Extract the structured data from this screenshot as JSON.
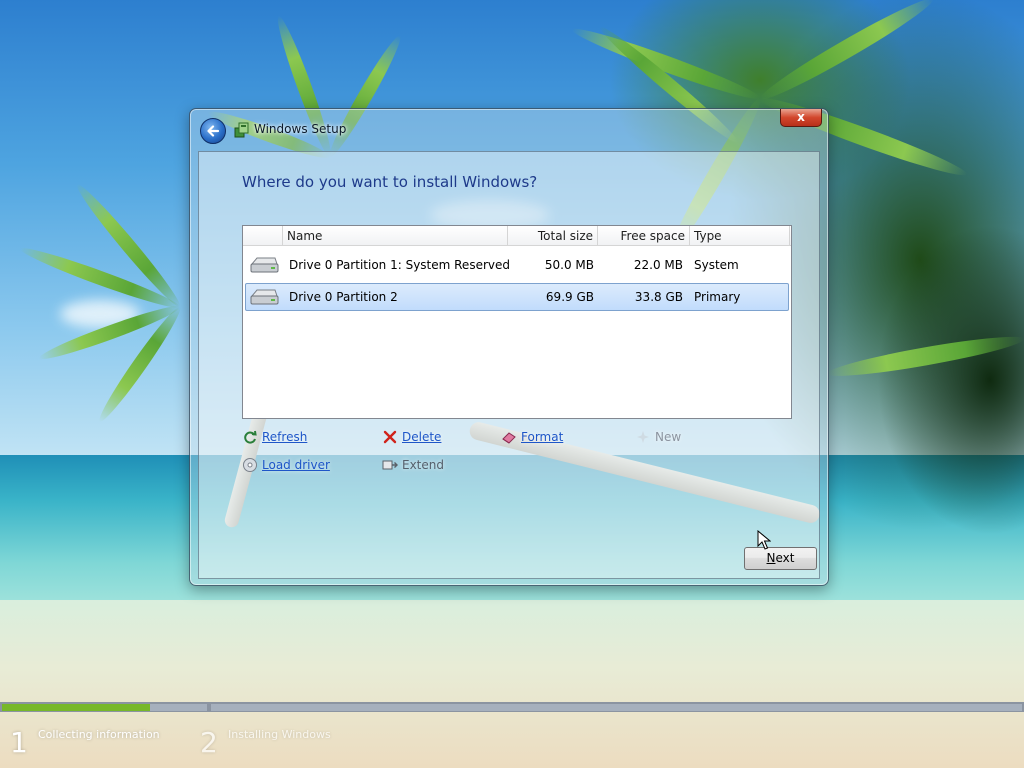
{
  "window": {
    "title": "Windows Setup",
    "heading": "Where do you want to install Windows?",
    "close_label": "x"
  },
  "partitions": {
    "columns": [
      "Name",
      "Total size",
      "Free space",
      "Type"
    ],
    "rows": [
      {
        "name": "Drive 0 Partition 1: System Reserved",
        "total": "50.0 MB",
        "free": "22.0 MB",
        "type": "System",
        "selected": false
      },
      {
        "name": "Drive 0 Partition 2",
        "total": "69.9 GB",
        "free": "33.8 GB",
        "type": "Primary",
        "selected": true
      }
    ]
  },
  "actions": {
    "refresh": "Refresh",
    "delete": "Delete",
    "format": "Format",
    "new": "New",
    "load_driver": "Load driver",
    "extend": "Extend"
  },
  "buttons": {
    "next_first": "N",
    "next_rest": "ext"
  },
  "steps": [
    {
      "number": "1",
      "label": "Collecting information"
    },
    {
      "number": "2",
      "label": "Installing Windows"
    }
  ],
  "progress": {
    "step1_fraction": 0.72
  },
  "colors": {
    "heading": "#1e3a8a",
    "link": "#1e56c8",
    "progress_fill": "#78b82a",
    "selection": "#c1dcfc"
  },
  "icons": {
    "back": "back-arrow-icon",
    "drive": "hard-drive-icon",
    "refresh": "refresh-icon",
    "delete": "delete-x-icon",
    "format": "eraser-icon",
    "new": "new-star-icon",
    "load_driver": "cd-driver-icon",
    "extend": "extend-icon"
  }
}
